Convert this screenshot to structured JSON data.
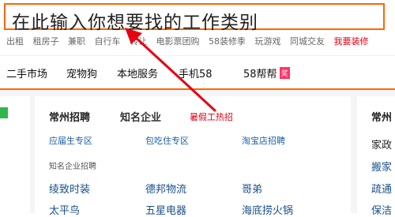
{
  "search": {
    "value": "在此输入你想要找的工作类别"
  },
  "hot_links": [
    "出租",
    "租房子",
    "兼职",
    "自行车",
    "转让",
    "电影票团购",
    "58装修季",
    "玩游戏",
    "同城交友",
    "我要装修"
  ],
  "nav": {
    "items": [
      "二手市场",
      "宠物狗",
      "本地服务",
      "手机58",
      "58帮帮"
    ],
    "badge": "奖"
  },
  "main": {
    "col1_title": "常州招聘",
    "col2_title": "知名企业",
    "col3_title": "暑假工热招",
    "row1": [
      "应届生专区",
      "包吃住专区",
      "淘宝店招聘"
    ],
    "subhead": "知名企业招聘",
    "row2": [
      "绫致时装",
      "德邦物流",
      "哥弟"
    ],
    "row3": [
      "太平鸟",
      "五星电器",
      "海底捞火锅"
    ]
  },
  "right": {
    "title": "常州",
    "items": [
      "家政",
      "搬家",
      "疏通",
      "保洁"
    ]
  },
  "colors": {
    "accent": "#ff6600",
    "highlight_red": "#e60012",
    "link": "#1c5ea0",
    "tag_green": "#2db84b"
  }
}
